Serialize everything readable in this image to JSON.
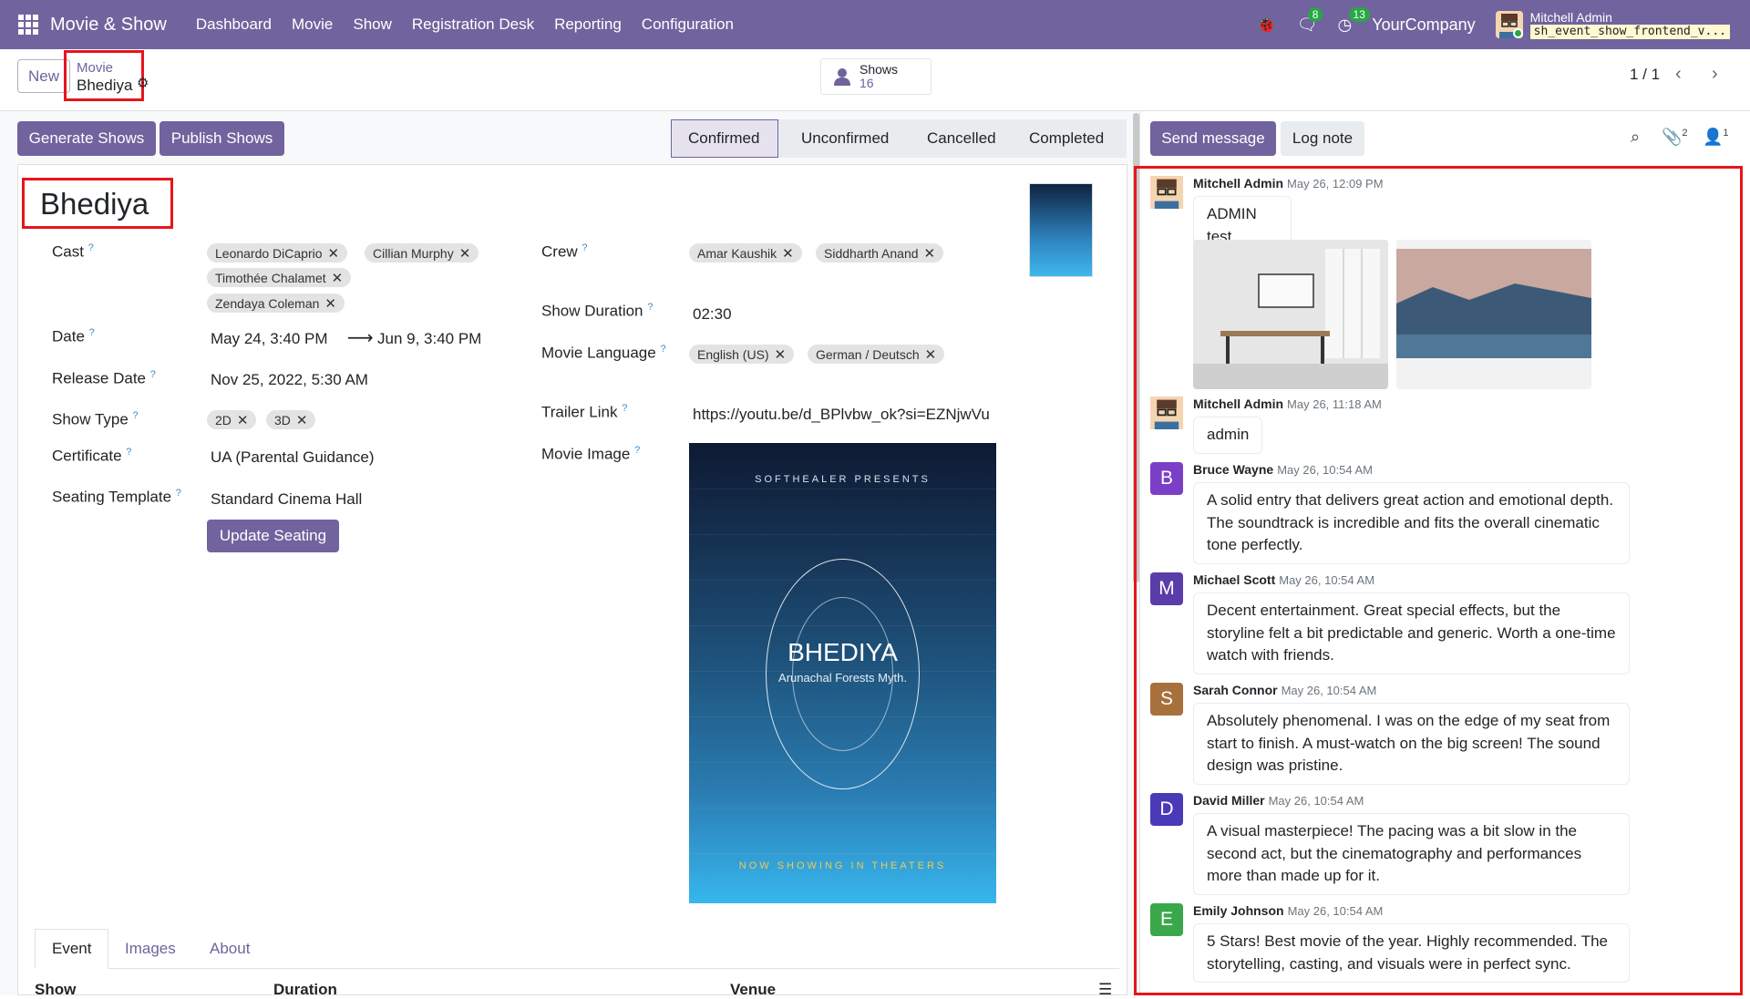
{
  "app": {
    "name": "Movie & Show",
    "menu": [
      "Dashboard",
      "Movie",
      "Show",
      "Registration Desk",
      "Reporting",
      "Configuration"
    ],
    "messages_count": "8",
    "activities_count": "13",
    "company": "YourCompany",
    "user": "Mitchell Admin",
    "db": "sh_event_show_frontend_v..."
  },
  "control": {
    "new_label": "New",
    "breadcrumb_parent": "Movie",
    "breadcrumb_current": "Bhediya",
    "shows_label": "Shows",
    "shows_count": "16",
    "pager": "1 / 1"
  },
  "actions": {
    "generate": "Generate Shows",
    "publish": "Publish Shows"
  },
  "status": {
    "stages": [
      "Confirmed",
      "Unconfirmed",
      "Cancelled",
      "Completed"
    ],
    "active": "Confirmed"
  },
  "form": {
    "title": "Bhediya",
    "cast_label": "Cast",
    "cast": [
      "Leonardo DiCaprio",
      "Cillian Murphy",
      "Timothée Chalamet",
      "Zendaya Coleman"
    ],
    "date_label": "Date",
    "date_start": "May 24, 3:40 PM",
    "date_end": "Jun 9, 3:40 PM",
    "release_label": "Release Date",
    "release_date": "Nov 25, 2022, 5:30 AM",
    "show_type_label": "Show Type",
    "show_types": [
      "2D",
      "3D"
    ],
    "certificate_label": "Certificate",
    "certificate": "UA (Parental Guidance)",
    "seating_label": "Seating Template",
    "seating": "Standard Cinema Hall",
    "update_seating": "Update Seating",
    "crew_label": "Crew",
    "crew": [
      "Amar Kaushik",
      "Siddharth Anand"
    ],
    "duration_label": "Show Duration",
    "duration": "02:30",
    "language_label": "Movie Language",
    "languages": [
      "English (US)",
      "German / Deutsch"
    ],
    "trailer_label": "Trailer Link",
    "trailer": "https://youtu.be/d_BPlvbw_ok?si=EZNjwVu",
    "image_label": "Movie Image"
  },
  "poster": {
    "top": "SOFTHEALER PRESENTS",
    "title": "BHEDIYA",
    "subtitle": "Arunachal Forests Myth.",
    "bottom": "NOW SHOWING IN THEATERS"
  },
  "tabs": [
    "Event",
    "Images",
    "About"
  ],
  "table_headers": [
    "Show",
    "Duration",
    "Venue"
  ],
  "chatter": {
    "send_message": "Send message",
    "log_note": "Log note",
    "attachments_count": "2",
    "followers_count": "1",
    "messages": [
      {
        "author": "Mitchell Admin",
        "time": "May 26, 12:09 PM",
        "text": "ADMIN test comments",
        "initial": "",
        "color": "#f4d5b0"
      },
      {
        "author": "Mitchell Admin",
        "time": "May 26, 11:18 AM",
        "text": "admin",
        "initial": "",
        "color": "#f4d5b0"
      },
      {
        "author": "Bruce Wayne",
        "time": "May 26, 10:54 AM",
        "text": "A solid entry that delivers great action and emotional depth. The soundtrack is incredible and fits the overall cinematic tone perfectly.",
        "initial": "B",
        "color": "#7b3fc7"
      },
      {
        "author": "Michael Scott",
        "time": "May 26, 10:54 AM",
        "text": "Decent entertainment. Great special effects, but the storyline felt a bit predictable and generic. Worth a one-time watch with friends.",
        "initial": "M",
        "color": "#5a3da8"
      },
      {
        "author": "Sarah Connor",
        "time": "May 26, 10:54 AM",
        "text": "Absolutely phenomenal. I was on the edge of my seat from start to finish. A must-watch on the big screen! The sound design was pristine.",
        "initial": "S",
        "color": "#a8703d"
      },
      {
        "author": "David Miller",
        "time": "May 26, 10:54 AM",
        "text": "A visual masterpiece! The pacing was a bit slow in the second act, but the cinematography and performances more than made up for it.",
        "initial": "D",
        "color": "#4a3ab8"
      },
      {
        "author": "Emily Johnson",
        "time": "May 26, 10:54 AM",
        "text": "5 Stars! Best movie of the year. Highly recommended. The storytelling, casting, and visuals were in perfect sync.",
        "initial": "E",
        "color": "#3aa84a"
      }
    ]
  },
  "colors": {
    "brand": "#71639e",
    "highlight": "#e8141c",
    "badge": "#28a745"
  }
}
